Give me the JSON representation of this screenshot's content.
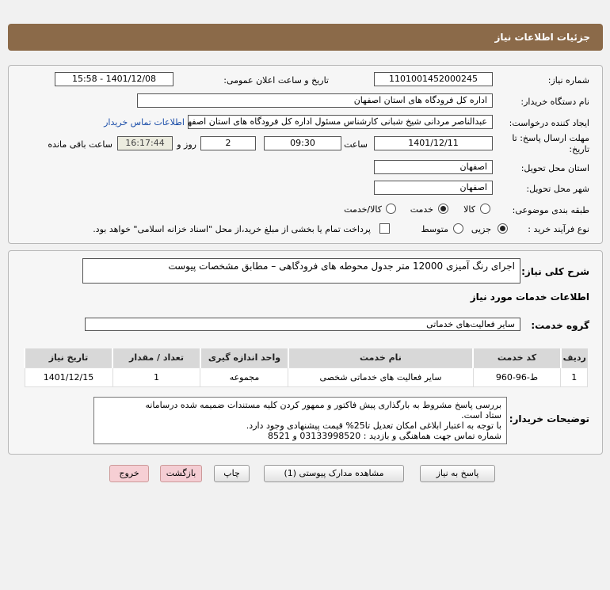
{
  "header": {
    "title": "جزئیات اطلاعات نیاز"
  },
  "form": {
    "need_number_label": "شماره نیاز:",
    "need_number": "1101001452000245",
    "announce_label": "تاریخ و ساعت اعلان عمومی:",
    "announce_value": "1401/12/08 - 15:58",
    "buyer_org_label": "نام دستگاه خریدار:",
    "buyer_org": "اداره کل فرودگاه های استان اصفهان",
    "creator_label": "ایجاد کننده درخواست:",
    "creator": "عبدالناصر مردانی شیخ شبانی کارشناس مسئول  اداره کل فرودگاه های استان اصفهان",
    "contact_link": "اطلاعات تماس خریدار",
    "deadline_label": "مهلت ارسال پاسخ: تا",
    "deadline_label2": "تاریخ:",
    "deadline_date": "1401/12/11",
    "time_label": "ساعت",
    "deadline_time": "09:30",
    "days_value": "2",
    "days_label": "روز و",
    "remaining_time": "16:17:44",
    "remaining_label": "ساعت باقی مانده",
    "province_label": "استان محل تحویل:",
    "province": "اصفهان",
    "city_label": "شهر محل تحویل:",
    "city": "اصفهان",
    "category_label": "طبقه بندی موضوعی:",
    "category_options": [
      "کالا",
      "خدمت",
      "کالا/خدمت"
    ],
    "category_selected": "خدمت",
    "process_label": "نوع فرآیند خرید :",
    "process_options": [
      "جزیی",
      "متوسط"
    ],
    "process_selected": "جزیی",
    "treasury_note": "پرداخت تمام یا بخشی از مبلغ خرید،از محل \"اسناد خزانه اسلامی\" خواهد بود."
  },
  "details": {
    "summary_label": "شرح کلی نیاز:",
    "summary": "اجرای رنگ آمیزی 12000 متر جدول محوطه های فرودگاهی – مطابق مشخصات پیوست",
    "services_heading": "اطلاعات خدمات مورد نیاز",
    "service_group_label": "گروه خدمت:",
    "service_group": "سایر فعالیت‌های خدماتی",
    "table_headers": [
      "ردیف",
      "کد خدمت",
      "نام خدمت",
      "واحد اندازه گیری",
      "تعداد / مقدار",
      "تاریخ نیاز"
    ],
    "table_rows": [
      [
        "1",
        "ط-96-960",
        "سایر فعالیت های خدماتی شخصی",
        "مجموعه",
        "1",
        "1401/12/15"
      ]
    ],
    "buyer_notes_label": "توضیحات خریدار:",
    "buyer_notes": [
      "بررسی پاسخ مشروط  به بارگذاری پیش فاکتور و ممهور کردن کلیه مستندات ضمیمه شده درسامانه",
      "ستاد است.",
      "با توجه به اعتبار ابلاغی امکان تعدیل تا25% قیمت پیشنهادی وجود دارد.",
      "شماره تماس جهت هماهنگی و  بازدید : 03133998520 و 8521"
    ]
  },
  "buttons": {
    "reply": "پاسخ به نیاز",
    "view_docs": "مشاهده مدارک پیوستی (1)",
    "print": "چاپ",
    "back": "بازگشت",
    "exit": "خروج"
  }
}
